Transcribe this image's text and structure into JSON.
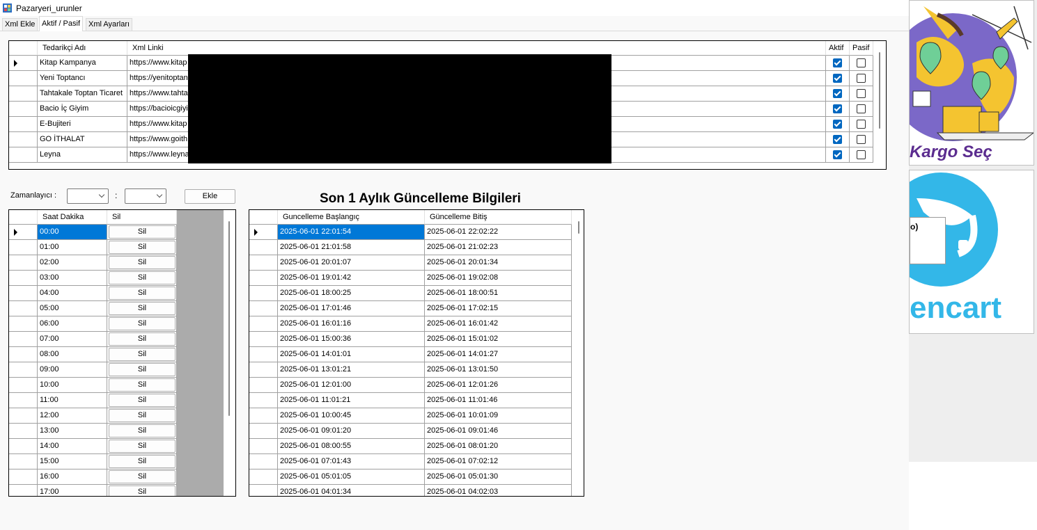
{
  "window": {
    "title": "Pazaryeri_urunler"
  },
  "tabs": [
    {
      "label": "Xml Ekle"
    },
    {
      "label": "Aktif / Pasif"
    },
    {
      "label": "Xml Ayarları"
    }
  ],
  "supplier_grid": {
    "columns": {
      "name": "Tedarikçi Adı",
      "xml": "Xml Linki",
      "active": "Aktif",
      "passive": "Pasif"
    },
    "rows": [
      {
        "name": "Kitap Kampanya",
        "xml": "https://www.kitap",
        "active": true,
        "passive": false
      },
      {
        "name": "Yeni Toptancı",
        "xml": "https://yenitoptan",
        "active": true,
        "passive": false
      },
      {
        "name": "Tahtakale Toptan Ticaret",
        "xml": "https://www.tahta",
        "active": true,
        "passive": false
      },
      {
        "name": "Bacio İç Giyim",
        "xml": "https://bacioicgiyi",
        "active": true,
        "passive": false
      },
      {
        "name": "E-Bujiteri",
        "xml": "https://www.kitap",
        "active": true,
        "passive": false
      },
      {
        "name": "GO İTHALAT",
        "xml": "https://www.goith",
        "active": true,
        "passive": false
      },
      {
        "name": "Leyna",
        "xml": "https://www.leyna",
        "active": true,
        "passive": false
      }
    ]
  },
  "scheduler": {
    "label": "Zamanlayıcı :",
    "separator": ":",
    "add_button": "Ekle"
  },
  "time_grid": {
    "columns": {
      "time": "Saat Dakika",
      "delete": "Sil"
    },
    "rows": [
      "00:00",
      "01:00",
      "02:00",
      "03:00",
      "04:00",
      "05:00",
      "06:00",
      "07:00",
      "08:00",
      "09:00",
      "10:00",
      "11:00",
      "12:00",
      "13:00",
      "14:00",
      "15:00",
      "16:00",
      "17:00"
    ],
    "delete_label": "Sil"
  },
  "update_section": {
    "title": "Son 1 Aylık Güncelleme Bilgileri",
    "columns": {
      "start": "Guncelleme Başlangıç",
      "end": "Güncelleme Bitiş"
    },
    "rows": [
      [
        "2025-06-01 22:01:54",
        "2025-06-01 22:02:22"
      ],
      [
        "2025-06-01 21:01:58",
        "2025-06-01 21:02:23"
      ],
      [
        "2025-06-01 20:01:07",
        "2025-06-01 20:01:34"
      ],
      [
        "2025-06-01 19:01:42",
        "2025-06-01 19:02:08"
      ],
      [
        "2025-06-01 18:00:25",
        "2025-06-01 18:00:51"
      ],
      [
        "2025-06-01 17:01:46",
        "2025-06-01 17:02:15"
      ],
      [
        "2025-06-01 16:01:16",
        "2025-06-01 16:01:42"
      ],
      [
        "2025-06-01 15:00:36",
        "2025-06-01 15:01:02"
      ],
      [
        "2025-06-01 14:01:01",
        "2025-06-01 14:01:27"
      ],
      [
        "2025-06-01 13:01:21",
        "2025-06-01 13:01:50"
      ],
      [
        "2025-06-01 12:01:00",
        "2025-06-01 12:01:26"
      ],
      [
        "2025-06-01 11:01:21",
        "2025-06-01 11:01:46"
      ],
      [
        "2025-06-01 10:00:45",
        "2025-06-01 10:01:09"
      ],
      [
        "2025-06-01 09:01:20",
        "2025-06-01 09:01:46"
      ],
      [
        "2025-06-01 08:00:55",
        "2025-06-01 08:01:20"
      ],
      [
        "2025-06-01 07:01:43",
        "2025-06-01 07:02:12"
      ],
      [
        "2025-06-01 05:01:05",
        "2025-06-01 05:01:30"
      ],
      [
        "2025-06-01 04:01:34",
        "2025-06-01 04:02:03"
      ]
    ]
  },
  "side_images": {
    "kargo_text": "Kargo Seç",
    "opencart_text": "encart",
    "popup_fragment": "o)"
  },
  "colors": {
    "checkbox_on": "#0067c0",
    "selection": "#0078d7",
    "redaction": "#000000",
    "kargo_globe": "#7b68c8",
    "opencart_blue": "#33b7e8"
  }
}
